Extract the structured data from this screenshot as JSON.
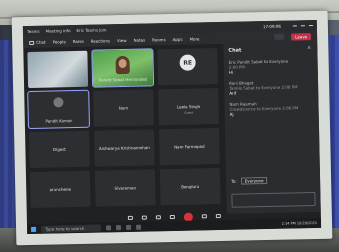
{
  "titlebar": {
    "items": [
      "Teams",
      "Meeting info",
      "Eric Teams Join"
    ],
    "timer": "17:09:06"
  },
  "menubar": {
    "items": [
      "Chat",
      "People",
      "Raise",
      "Reactions",
      "View",
      "Notes",
      "Rooms",
      "Apps",
      "More"
    ],
    "leave_label": "Leave"
  },
  "gallery": {
    "tiles": [
      {
        "kind": "video-gray",
        "name": ""
      },
      {
        "kind": "video-person",
        "name": "Pandit Sabat Hernandez"
      },
      {
        "kind": "avatar",
        "initials": "RE",
        "name": ""
      },
      {
        "kind": "video-person-small",
        "name": "Pandit Kumar"
      },
      {
        "kind": "text",
        "name": "Nam"
      },
      {
        "kind": "text",
        "name": "Leela Singh",
        "sub": "Guest"
      },
      {
        "kind": "text",
        "name": "Digest"
      },
      {
        "kind": "text",
        "name": "Aishwarya Krishnamohan"
      },
      {
        "kind": "text",
        "name": "Nam Farmapad"
      },
      {
        "kind": "text",
        "name": "arunchene"
      },
      {
        "kind": "text",
        "name": "Sivaraman"
      },
      {
        "kind": "text",
        "name": "Bengluru"
      }
    ]
  },
  "chat": {
    "title": "Chat",
    "close_glyph": "×",
    "messages": [
      {
        "from": "Eric Pandit Sabat to Everyone",
        "time": "2:00 PM",
        "body": "Hi"
      },
      {
        "from": "Rani Bhagat",
        "time": "Tamile Sabat to Everyone 2:06 PM",
        "body": "Arif"
      },
      {
        "from": "Nam Raamah",
        "time": "Crowdsource to Everyone 3:06 PM",
        "body": "Aj"
      }
    ],
    "to_label": "To:",
    "to_value": "Everyone"
  },
  "taskbar": {
    "search_placeholder": "Type here to search",
    "clock": "2:14 PM 10/28/2021"
  },
  "colors": {
    "leave": "#c4314b",
    "end_call": "#d9323b",
    "app_bg": "#1f2123",
    "accent": "#9ea7ff"
  }
}
